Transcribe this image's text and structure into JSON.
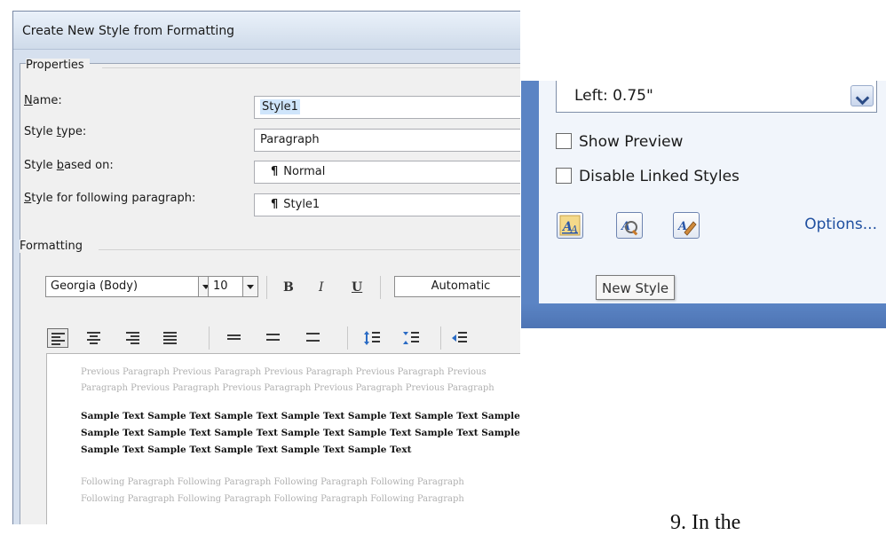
{
  "dialog": {
    "title": "Create New Style from Formatting",
    "properties_label": "Properties",
    "fields": [
      {
        "label_pre": "",
        "label_key": "N",
        "label_post": "ame:",
        "value": "Style1"
      },
      {
        "label_pre": "Style ",
        "label_key": "t",
        "label_post": "ype:",
        "value": "Paragraph"
      },
      {
        "label_pre": "Style ",
        "label_key": "b",
        "label_post": "ased on:",
        "value": "Normal"
      },
      {
        "label_pre": "",
        "label_key": "S",
        "label_post": "tyle for following paragraph:",
        "value": "Style1"
      }
    ],
    "formatting_label": "Formatting",
    "font": "Georgia (Body)",
    "size": "10",
    "bold": "B",
    "italic": "I",
    "underline": "U",
    "color": "Automatic",
    "preview": {
      "previous": [
        "Previous Paragraph Previous Paragraph Previous Paragraph Previous Paragraph Previous",
        "Paragraph Previous Paragraph Previous Paragraph Previous Paragraph Previous Paragraph"
      ],
      "sample": [
        "Sample Text Sample Text Sample Text Sample Text Sample Text Sample Text Sample",
        "Sample Text Sample Text Sample Text Sample Text Sample Text Sample Text Sample",
        "Sample Text Sample Text Sample Text Sample Text Sample Text"
      ],
      "following": [
        "Following Paragraph Following Paragraph Following Paragraph Following Paragraph",
        "Following Paragraph Following Paragraph Following Paragraph Following Paragraph"
      ]
    }
  },
  "styles_pane": {
    "indent_value": "Left:  0.75\"",
    "show_preview": "Show Preview",
    "disable_linked": "Disable Linked Styles",
    "options_link": "Options...",
    "tooltip": "New Style"
  },
  "page": {
    "fragment": "9.   In the"
  }
}
